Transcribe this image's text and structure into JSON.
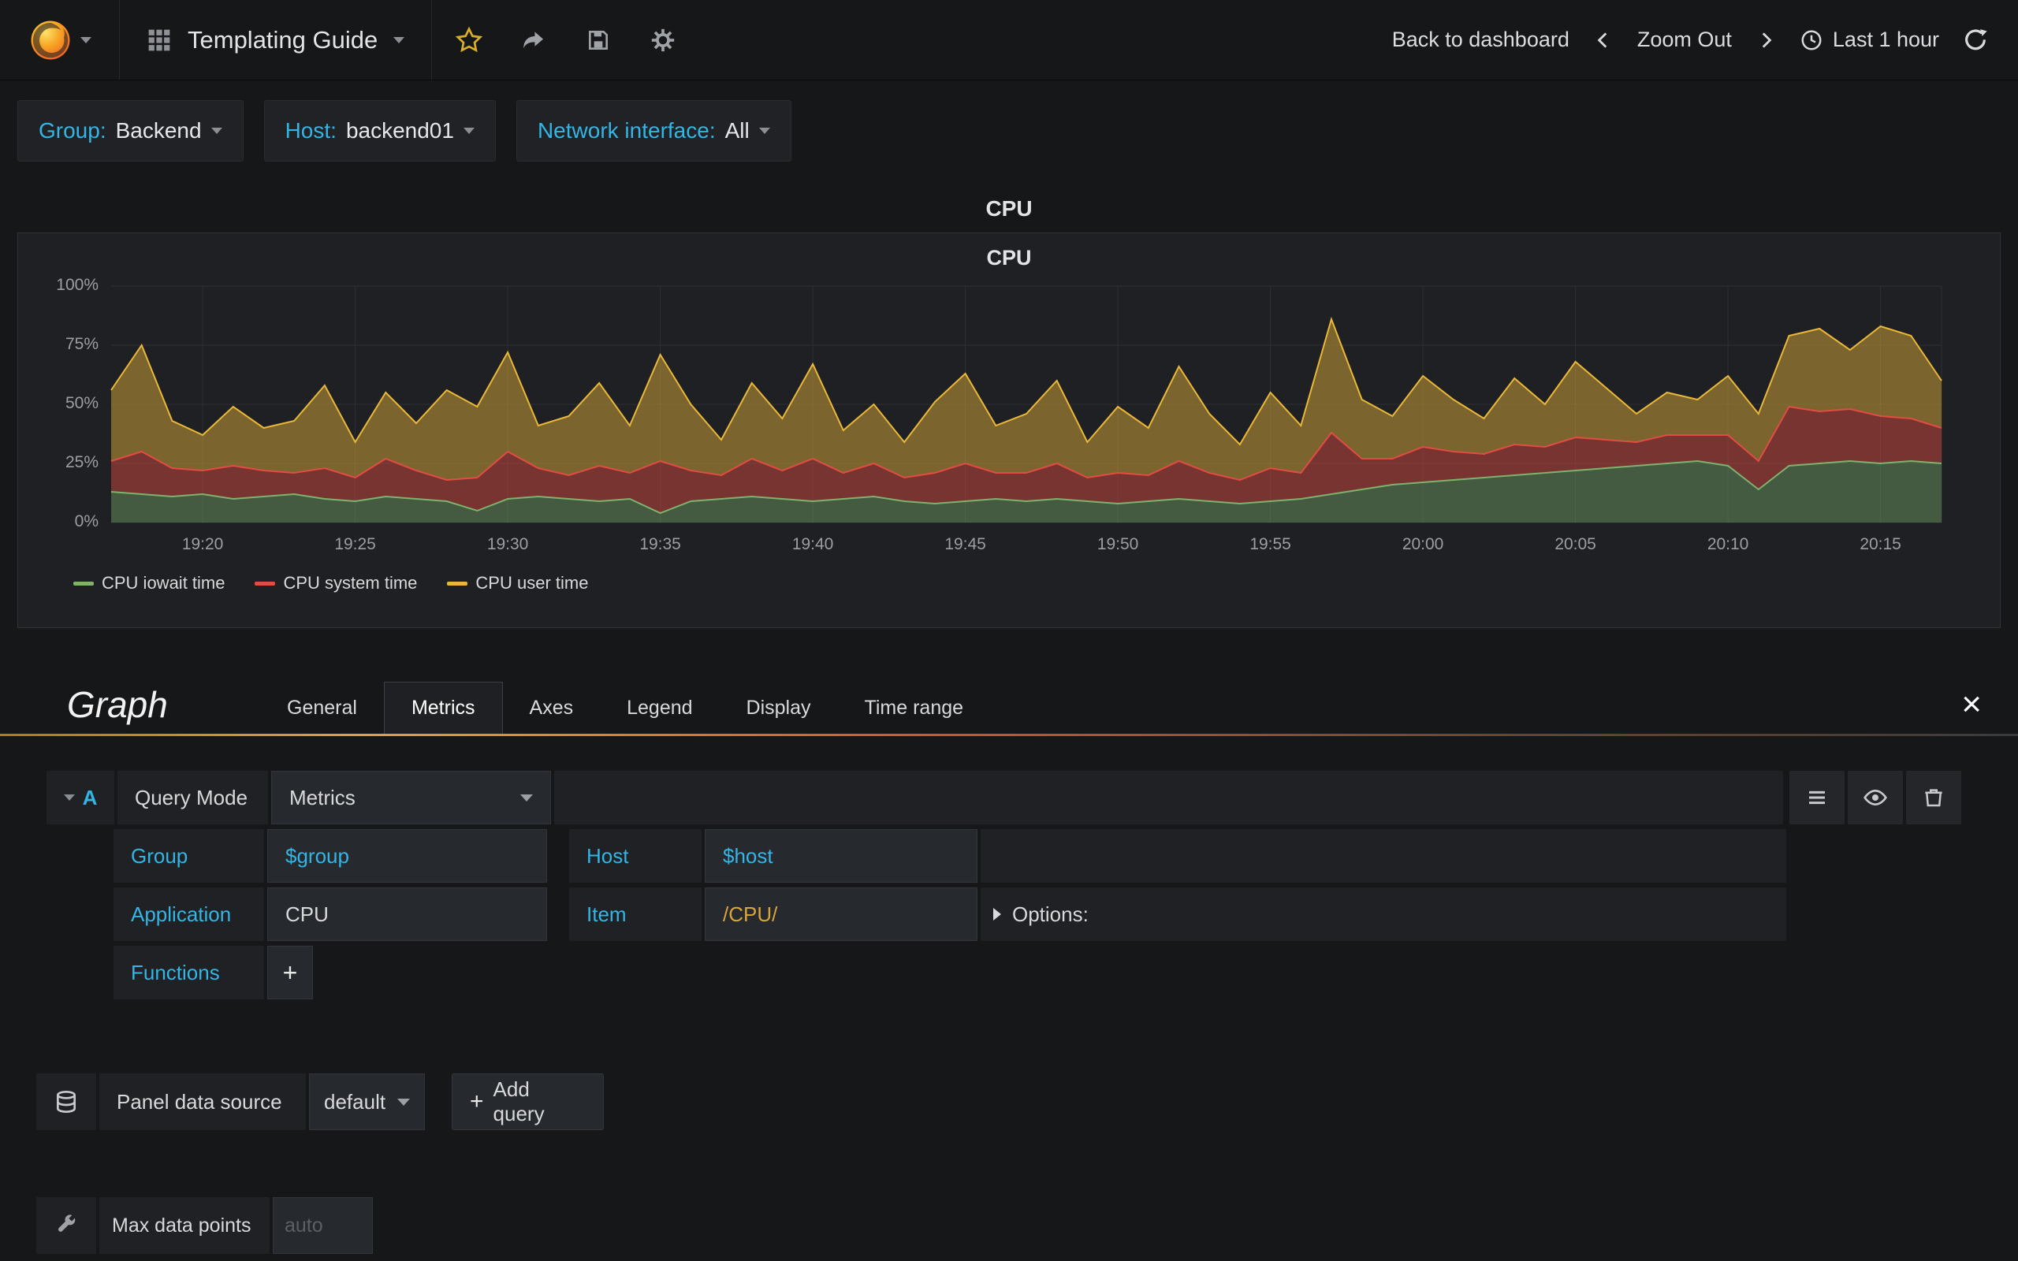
{
  "navbar": {
    "title": "Templating Guide",
    "back_to_dashboard": "Back to dashboard",
    "zoom_out": "Zoom Out",
    "time_range": "Last 1 hour"
  },
  "variables": [
    {
      "label": "Group:",
      "value": "Backend"
    },
    {
      "label": "Host:",
      "value": "backend01"
    },
    {
      "label": "Network interface:",
      "value": "All"
    }
  ],
  "panel": {
    "outer_title": "CPU",
    "title": "CPU"
  },
  "chart_data": {
    "type": "area",
    "stacked": true,
    "title": "CPU",
    "ylim": [
      0,
      100
    ],
    "grid": true,
    "legend_position": "bottom-left",
    "y_ticks": [
      {
        "label": "0%",
        "v": 0
      },
      {
        "label": "25%",
        "v": 25
      },
      {
        "label": "50%",
        "v": 50
      },
      {
        "label": "75%",
        "v": 75
      },
      {
        "label": "100%",
        "v": 100
      }
    ],
    "x_minutes_start": 0,
    "x_minutes_end": 60,
    "x_ticks": [
      {
        "label": "19:20",
        "t": 3
      },
      {
        "label": "19:25",
        "t": 8
      },
      {
        "label": "19:30",
        "t": 13
      },
      {
        "label": "19:35",
        "t": 18
      },
      {
        "label": "19:40",
        "t": 23
      },
      {
        "label": "19:45",
        "t": 28
      },
      {
        "label": "19:50",
        "t": 33
      },
      {
        "label": "19:55",
        "t": 38
      },
      {
        "label": "20:00",
        "t": 43
      },
      {
        "label": "20:05",
        "t": 48
      },
      {
        "label": "20:10",
        "t": 53
      },
      {
        "label": "20:15",
        "t": 58
      }
    ],
    "series": [
      {
        "name": "CPU iowait time",
        "color": "#7EB26D",
        "fill": "rgba(126,178,109,0.40)",
        "values": [
          13,
          12,
          11,
          12,
          10,
          11,
          12,
          10,
          9,
          11,
          10,
          9,
          5,
          10,
          11,
          10,
          9,
          10,
          4,
          9,
          10,
          11,
          10,
          9,
          10,
          11,
          9,
          8,
          9,
          10,
          9,
          10,
          9,
          8,
          9,
          10,
          9,
          8,
          9,
          10,
          12,
          14,
          16,
          17,
          18,
          19,
          20,
          21,
          22,
          23,
          24,
          25,
          26,
          24,
          14,
          24,
          25,
          26,
          25,
          26,
          25
        ]
      },
      {
        "name": "CPU system time",
        "color": "#E24D42",
        "fill": "rgba(226,77,66,0.45)",
        "values": [
          13,
          18,
          12,
          10,
          14,
          11,
          9,
          13,
          10,
          16,
          12,
          9,
          14,
          20,
          12,
          10,
          15,
          11,
          22,
          13,
          10,
          16,
          12,
          18,
          11,
          14,
          10,
          13,
          16,
          11,
          12,
          15,
          10,
          13,
          11,
          16,
          12,
          10,
          14,
          11,
          26,
          13,
          11,
          15,
          12,
          10,
          13,
          11,
          14,
          12,
          10,
          12,
          11,
          13,
          12,
          25,
          22,
          22,
          20,
          18,
          15
        ]
      },
      {
        "name": "CPU user time",
        "color": "#EAB839",
        "fill": "rgba(234,184,57,0.45)",
        "values": [
          30,
          45,
          20,
          15,
          25,
          18,
          22,
          35,
          15,
          28,
          20,
          38,
          30,
          42,
          18,
          25,
          35,
          20,
          45,
          28,
          15,
          32,
          22,
          40,
          18,
          25,
          15,
          30,
          38,
          20,
          25,
          35,
          15,
          28,
          20,
          40,
          25,
          15,
          32,
          20,
          48,
          25,
          18,
          30,
          22,
          15,
          28,
          18,
          32,
          22,
          12,
          18,
          15,
          25,
          20,
          30,
          35,
          25,
          38,
          35,
          20
        ]
      }
    ]
  },
  "editor": {
    "panel_type": "Graph",
    "tabs": [
      "General",
      "Metrics",
      "Axes",
      "Legend",
      "Display",
      "Time range"
    ],
    "active_tab": "Metrics",
    "close_icon": "×",
    "query": {
      "letter": "A",
      "mode_label": "Query Mode",
      "mode_value": "Metrics",
      "group_label": "Group",
      "group_value": "$group",
      "host_label": "Host",
      "host_value": "$host",
      "application_label": "Application",
      "application_value": "CPU",
      "item_label": "Item",
      "item_value": "/CPU/",
      "options_label": "Options:",
      "functions_label": "Functions",
      "add_function_icon": "+"
    },
    "datasource": {
      "label": "Panel data source",
      "value": "default",
      "add_icon": "+",
      "add_query_label": "Add query"
    },
    "max_data_points": {
      "label": "Max data points",
      "placeholder": "auto"
    }
  }
}
